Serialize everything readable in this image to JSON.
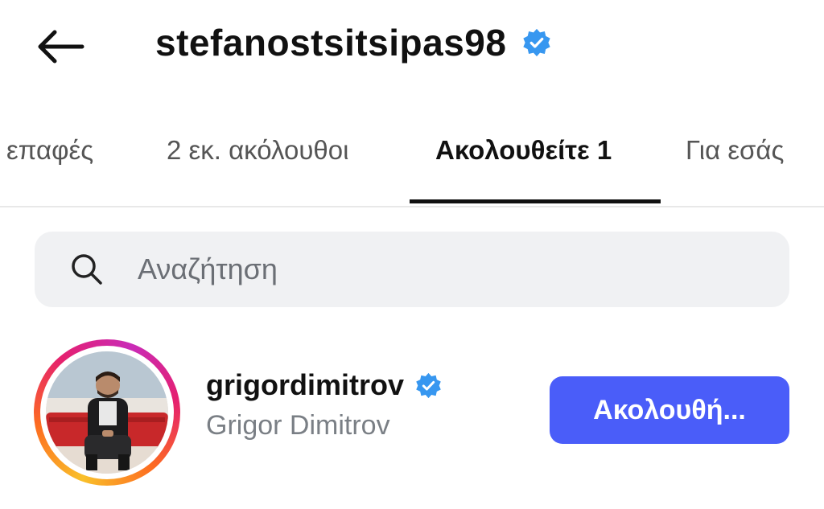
{
  "header": {
    "title": "stefanostsitsipas98",
    "back_icon": "arrow-left-icon",
    "verified_icon": "verified-badge-icon"
  },
  "tabs": [
    {
      "label": "επαφές",
      "active": false
    },
    {
      "label": "2 εκ. ακόλουθοι",
      "active": false
    },
    {
      "label": "Ακολουθείτε 1",
      "active": true
    },
    {
      "label": "Για εσάς",
      "active": false
    }
  ],
  "search": {
    "placeholder": "Αναζήτηση",
    "value": ""
  },
  "following": [
    {
      "username": "grigordimitrov",
      "full_name": "Grigor Dimitrov",
      "verified": true,
      "button_label": "Ακολουθή..."
    }
  ],
  "colors": {
    "accent_button": "#4a5df9",
    "verified_blue": "#3797f0",
    "tab_underline": "#111111"
  }
}
